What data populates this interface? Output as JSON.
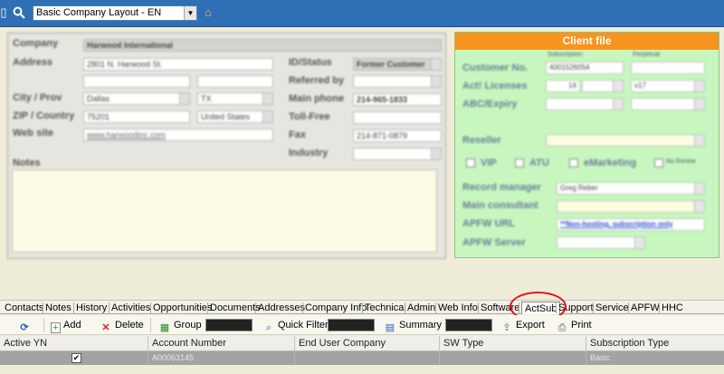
{
  "topbar": {
    "layout_select": "Basic Company Layout - EN",
    "icons": [
      "filter-icon",
      "search-icon",
      "chevron-down-icon",
      "home-icon"
    ]
  },
  "company_form": {
    "company_label": "Company",
    "company_value": "Harwood International",
    "address_label": "Address",
    "address_value": "2801 N. Harwood St.",
    "city_label": "City / Prov",
    "city_value": "Dallas",
    "prov_value": "TX",
    "zip_label": "ZIP / Country",
    "zip_value": "75201",
    "country_value": "United States",
    "website_label": "Web site",
    "website_value": "www.harwoodinc.com",
    "notes_label": "Notes",
    "id_status_label": "ID/Status",
    "id_status_value": "Former Customer",
    "referred_label": "Referred by",
    "main_phone_label": "Main phone",
    "main_phone_value": "214-965-1833",
    "toll_free_label": "Toll-Free",
    "fax_label": "Fax",
    "fax_value": "214-871-0879",
    "industry_label": "Industry"
  },
  "client_file": {
    "title": "Client file",
    "subscription_col": "Subscription",
    "perpetual_col": "Perpetual",
    "customer_no_label": "Customer No.",
    "customer_no_value": "4001526054",
    "act_licenses_label": "Act! Licenses",
    "act_licenses_value": "14",
    "act_version_value": "v17",
    "abc_label": "ABC/Expiry",
    "reseller_label": "Reseller",
    "vip_label": "VIP",
    "atu_label": "ATU",
    "emarketing_label": "eMarketing",
    "no_renew_label": "No Renew",
    "record_manager_label": "Record manager",
    "record_manager_value": "Greg Reber",
    "main_consultant_label": "Main consultant",
    "apfw_url_label": "APFW URL",
    "apfw_url_value": "**Non-hosting, subscription only",
    "apfw_server_label": "APFW Server"
  },
  "tabs": [
    "Contacts",
    "Notes",
    "History",
    "Activities",
    "Opportunities",
    "Documents",
    "Addresses",
    "Company Info",
    "Technical",
    "Admin",
    "Web Info",
    "Software",
    "ActSub",
    "Support",
    "Service",
    "APFW",
    "HHC"
  ],
  "active_tab": "ActSub",
  "toolbar": {
    "add": "Add",
    "delete": "Delete",
    "group": "Group",
    "quick_filter": "Quick Filter",
    "summary": "Summary",
    "export": "Export",
    "print": "Print"
  },
  "grid": {
    "columns": [
      "Active YN",
      "Account Number",
      "End User Company",
      "SW Type",
      "Subscription Type"
    ],
    "rows": [
      {
        "active": "✔",
        "account_number": "A00063145",
        "end_user_company": "",
        "sw_type": "",
        "subscription_type": "Basic"
      }
    ]
  }
}
